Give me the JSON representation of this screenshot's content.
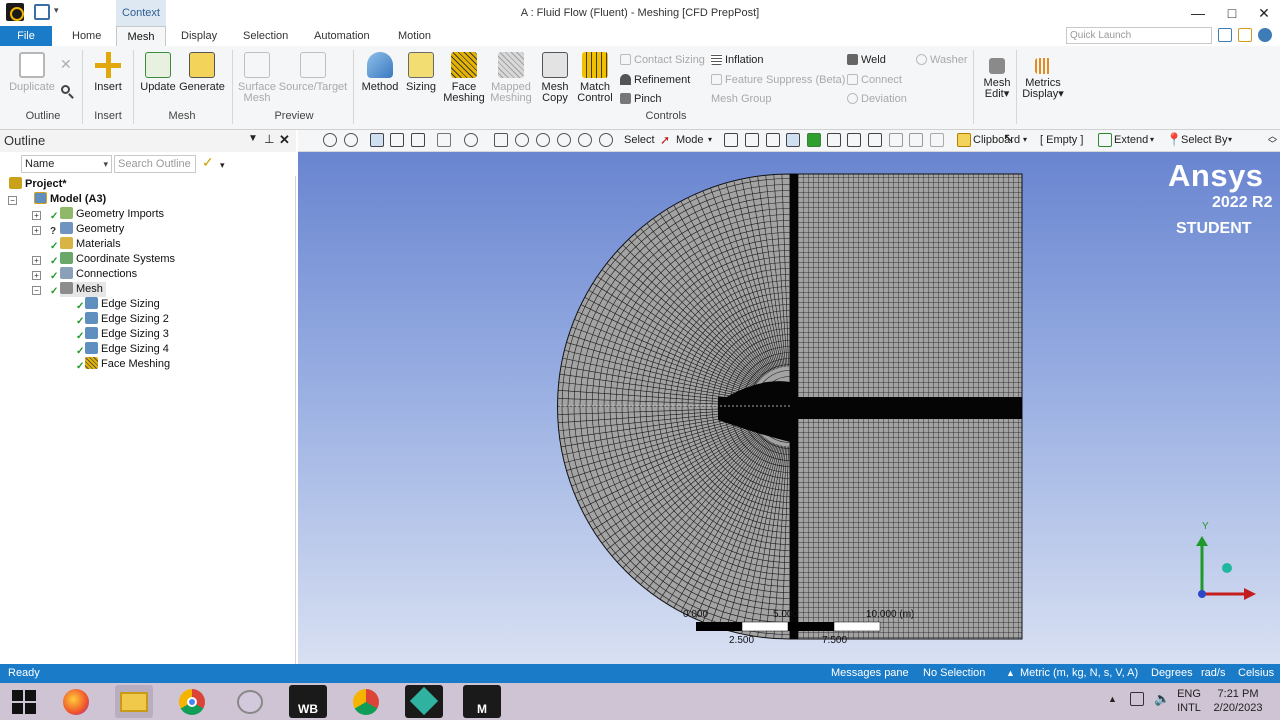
{
  "window": {
    "title": "A : Fluid Flow (Fluent) - Meshing [CFD PrepPost]",
    "context_tab": "Context",
    "minimize": "—",
    "maximize": "□",
    "close": "✕"
  },
  "tabs": {
    "file": "File",
    "items": [
      "Home",
      "Mesh",
      "Display",
      "Selection",
      "Automation",
      "Motion"
    ],
    "active": "Mesh",
    "quick_launch_placeholder": "Quick Launch"
  },
  "ribbon": {
    "groups": {
      "outline": "Outline",
      "insert": "Insert",
      "mesh": "Mesh",
      "preview": "Preview",
      "controls": "Controls"
    },
    "buttons": {
      "duplicate": "Duplicate",
      "insert": "Insert",
      "update": "Update",
      "generate": "Generate",
      "surface_mesh_1": "Surface",
      "surface_mesh_2": "Mesh",
      "source_target": "Source/Target",
      "method": "Method",
      "sizing": "Sizing",
      "face_meshing_1": "Face",
      "face_meshing_2": "Meshing",
      "mapped_meshing_1": "Mapped",
      "mapped_meshing_2": "Meshing",
      "mesh_copy_1": "Mesh",
      "mesh_copy_2": "Copy",
      "match_control_1": "Match",
      "match_control_2": "Control",
      "contact_sizing": "Contact Sizing",
      "refinement": "Refinement",
      "pinch": "Pinch",
      "inflation": "Inflation",
      "feature_suppress": "Feature Suppress (Beta)",
      "mesh_group": "Mesh Group",
      "weld": "Weld",
      "connect": "Connect",
      "deviation": "Deviation",
      "washer": "Washer",
      "mesh_edit_1": "Mesh",
      "mesh_edit_2": "Edit",
      "metrics_display_1": "Metrics",
      "metrics_display_2": "Display"
    }
  },
  "outline": {
    "title": "Outline",
    "name_select": "Name",
    "search_placeholder": "Search Outline",
    "tree": {
      "project": "Project*",
      "model": "Model (A3)",
      "geometry_imports": "Geometry Imports",
      "geometry": "Geometry",
      "materials": "Materials",
      "coordinate_systems": "Coordinate Systems",
      "connections": "Connections",
      "mesh": "Mesh",
      "edge_sizing_1": "Edge Sizing",
      "edge_sizing_2": "Edge Sizing 2",
      "edge_sizing_3": "Edge Sizing 3",
      "edge_sizing_4": "Edge Sizing 4",
      "face_meshing": "Face Meshing"
    }
  },
  "graphics_toolbar": {
    "select": "Select",
    "mode": "Mode",
    "clipboard": "Clipboard",
    "empty": "[ Empty ]",
    "extend": "Extend",
    "select_by": "Select By"
  },
  "viewport": {
    "brand": "Ansys",
    "version": "2022 R2",
    "edition": "STUDENT",
    "scale": {
      "tick_0": "0.000",
      "tick_5": "5.000",
      "tick_10": "10.000 (m)",
      "tick_2_5": "2.500",
      "tick_7_5": "7.500"
    },
    "triad_y": "Y"
  },
  "status": {
    "ready": "Ready",
    "messages": "Messages pane",
    "selection": "No Selection",
    "units": "Metric (m, kg, N, s, V, A)",
    "angle": "Degrees",
    "rate": "rad/s",
    "temperature": "Celsius"
  },
  "taskbar": {
    "wb_label": "WB",
    "m_label": "M",
    "lang_1": "ENG",
    "lang_2": "INTL",
    "time": "7:21 PM",
    "date": "2/20/2023"
  },
  "colors": {
    "accent": "#1a7bc8",
    "viewport_top": "#6985d0",
    "viewport_bottom": "#d8e0f2",
    "mesh_fill": "#9e9e9e",
    "taskbar": "#cfc4d4"
  }
}
